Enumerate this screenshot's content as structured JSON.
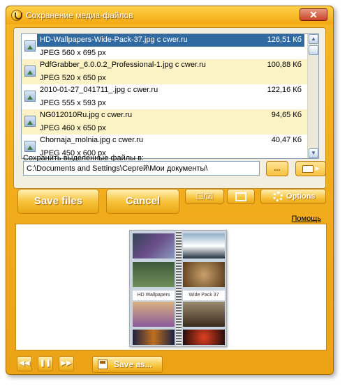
{
  "window": {
    "title": "Сохранение медиа-файлов",
    "close_label": "✕"
  },
  "files": [
    {
      "name": "HD-Wallpapers-Wide-Pack-37.jpg с cwer.ru",
      "size": "126,51 Кб",
      "info": "JPEG  560 x 695 px",
      "selected": true
    },
    {
      "name": "PdfGrabber_6.0.0.2_Professional-1.jpg с cwer.ru",
      "size": "100,88 Кб",
      "info": "JPEG  520 x 650 px",
      "selected": false
    },
    {
      "name": "2010-01-27_041711_.jpg с cwer.ru",
      "size": "122,16 Кб",
      "info": "JPEG  555 x 593 px",
      "selected": false
    },
    {
      "name": "NG012010Ru.jpg с cwer.ru",
      "size": "94,65 Кб",
      "info": "JPEG  460 x 650 px",
      "selected": false
    },
    {
      "name": "Chornaja_molnia.jpg с cwer.ru",
      "size": "40,47 Кб",
      "info": "JPEG  450 x 600 px",
      "selected": false
    }
  ],
  "save_section": {
    "label": "Сохранить выделенные файлы в:",
    "path": "C:\\Documents and Settings\\Сергей\\Мои документы\\",
    "browse_label": "...",
    "folder_label": "▸"
  },
  "actions": {
    "save_files": "Save files",
    "cancel": "Cancel",
    "select_all_label": "☐/☑",
    "options": "Options"
  },
  "help_link": "Помощь",
  "preview": {
    "left_caption": "HD Wallpapers",
    "right_caption": "Wide Pack 37"
  },
  "bottom": {
    "prev_label": "◀◀",
    "pause_label": "❚❚",
    "next_label": "▶▶",
    "save_as": "Save as..."
  },
  "colors": {
    "window_orange": "#f2a812",
    "selection_blue": "#316aa0",
    "alt_row": "#fbf3c6"
  }
}
